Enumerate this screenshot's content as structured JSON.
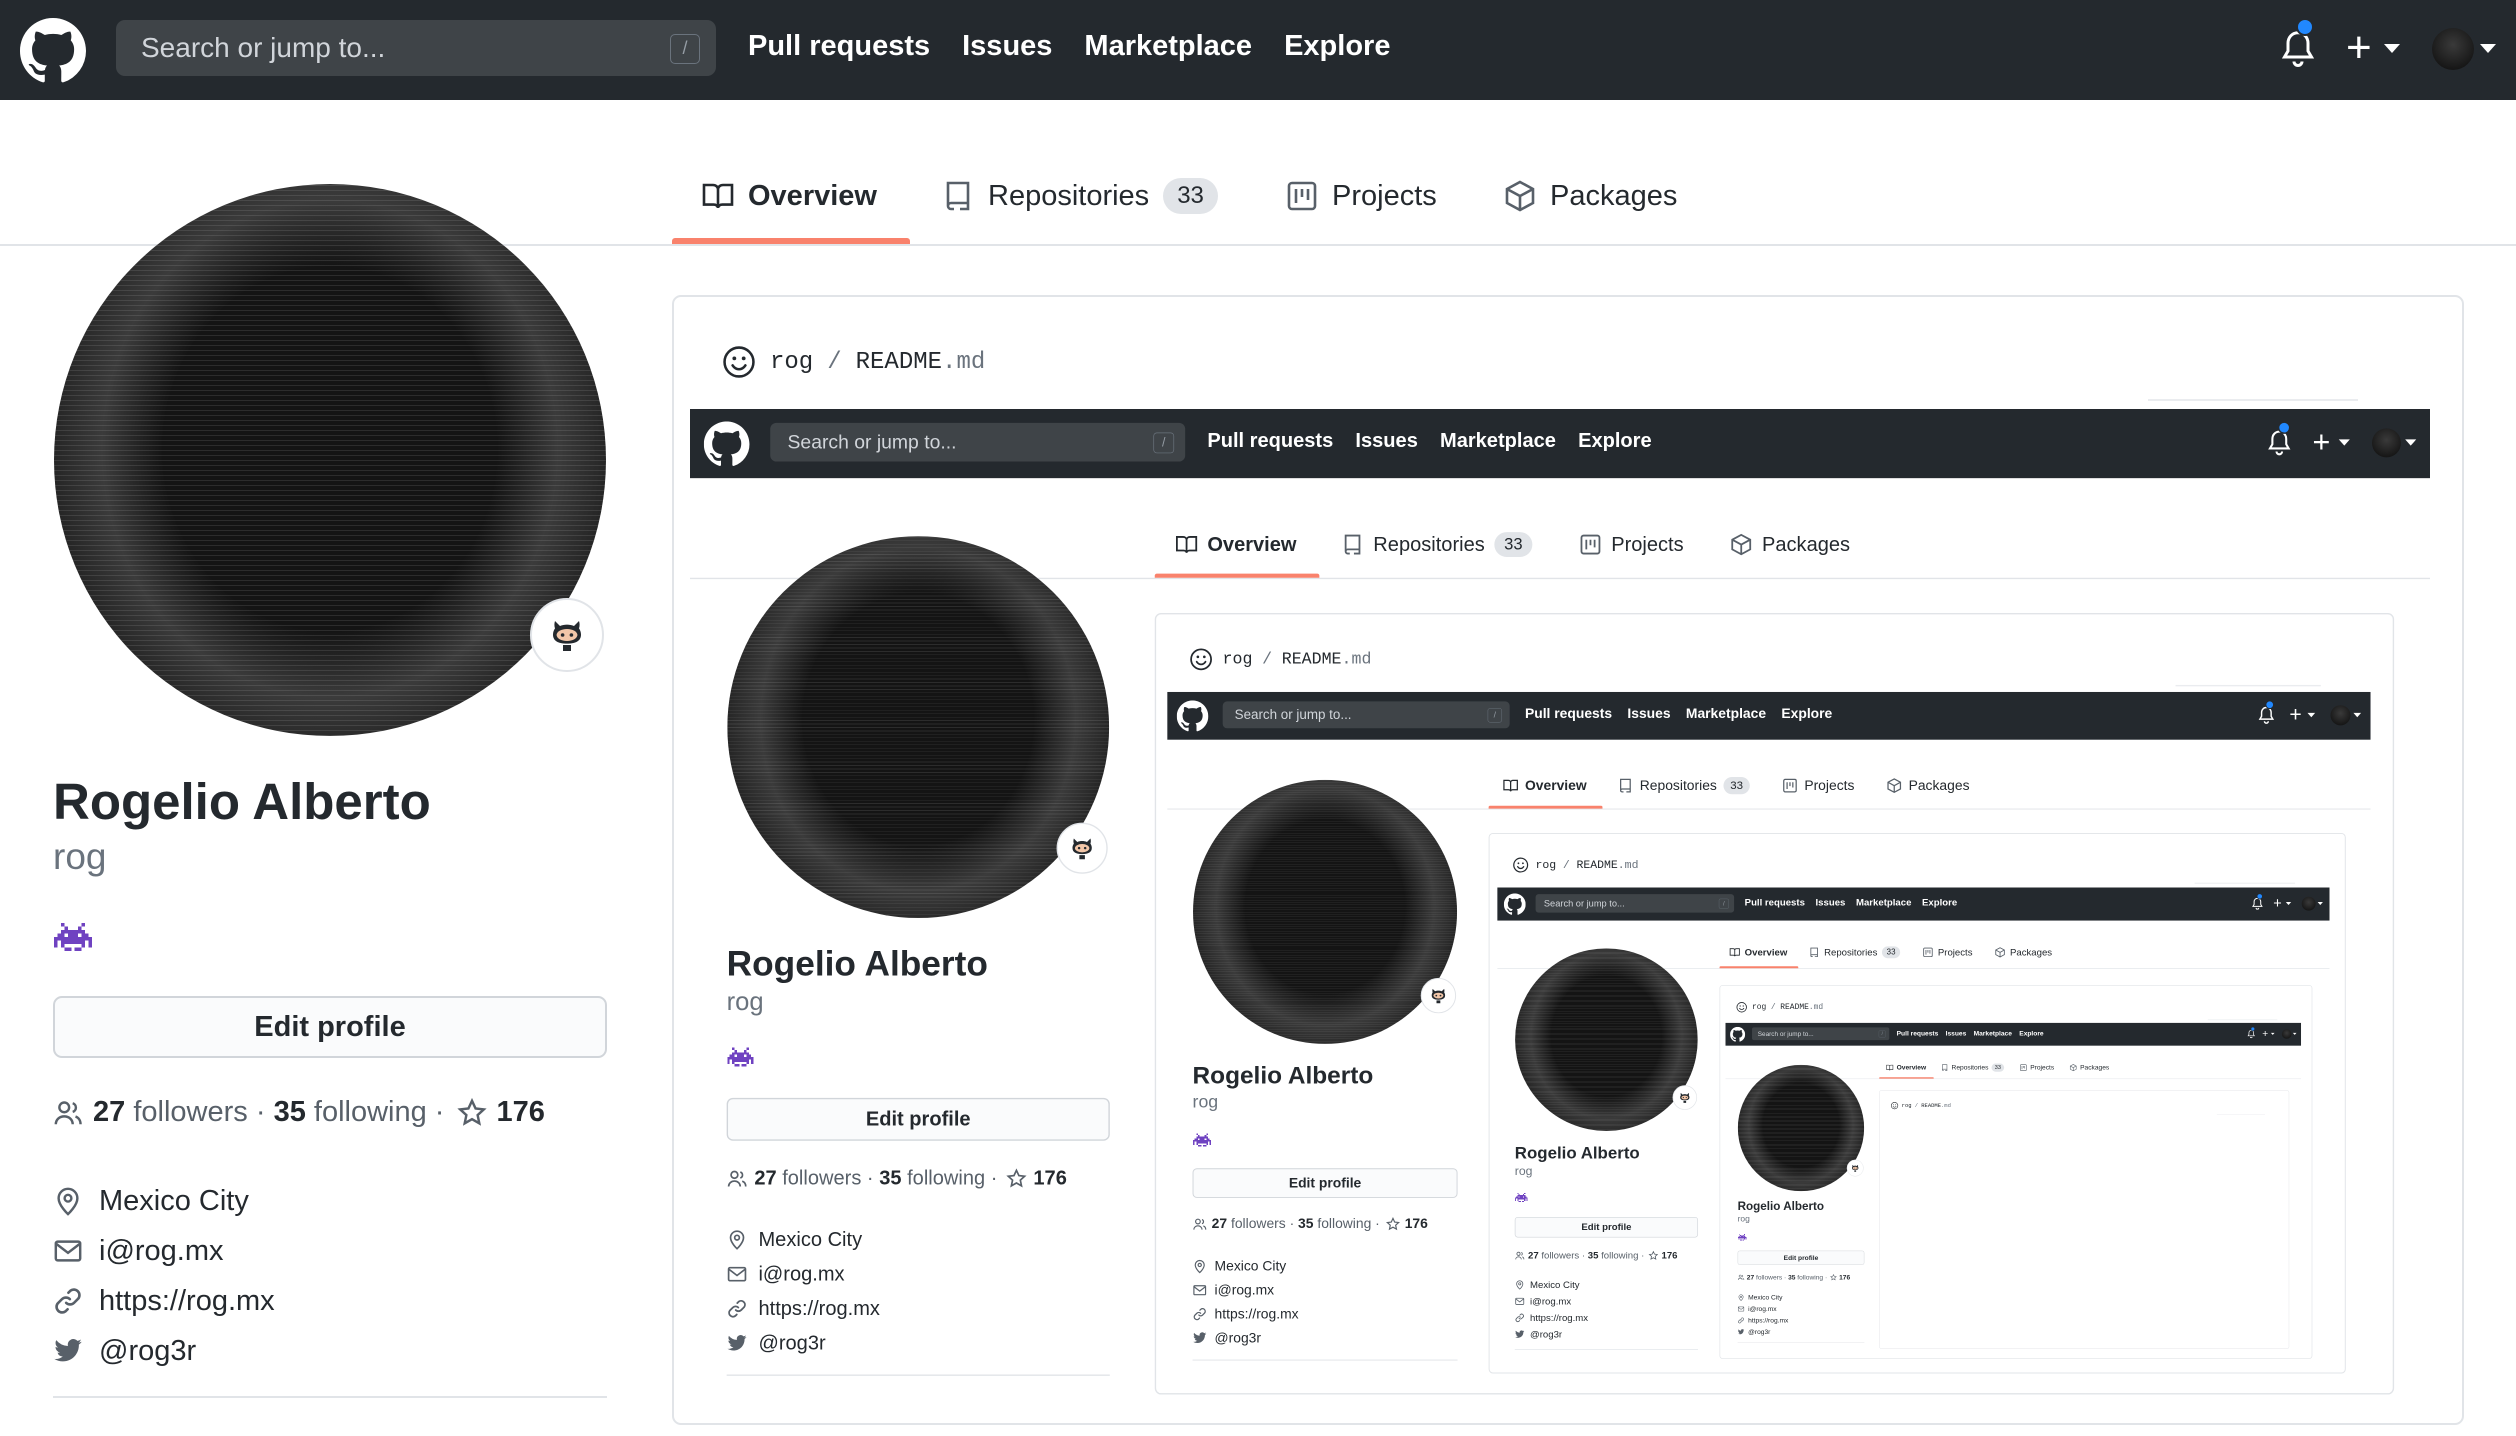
{
  "nav": {
    "search_placeholder": "Search or jump to...",
    "search_shortcut": "/",
    "links": [
      "Pull requests",
      "Issues",
      "Marketplace",
      "Explore"
    ],
    "plus": "+"
  },
  "tabs": [
    {
      "label": "Overview",
      "active": true
    },
    {
      "label": "Repositories",
      "count": "33"
    },
    {
      "label": "Projects"
    },
    {
      "label": "Packages"
    }
  ],
  "profile": {
    "full_name": "Rogelio Alberto",
    "username": "rog",
    "edit_label": "Edit profile",
    "followers": "27",
    "followers_label": "followers",
    "following": "35",
    "following_label": "following",
    "sep": "·",
    "stars": "176",
    "location": "Mexico City",
    "email": "i@rog.mx",
    "website": "https://rog.mx",
    "twitter": "@rog3r"
  },
  "readme": {
    "owner": "rog",
    "slash": "/",
    "file": "README",
    "ext": ".md"
  },
  "colors": {
    "nav_bg": "#24292e",
    "tab_underline": "#f9826c",
    "notification_dot": "#2188ff",
    "invader": "#6f42c1"
  }
}
